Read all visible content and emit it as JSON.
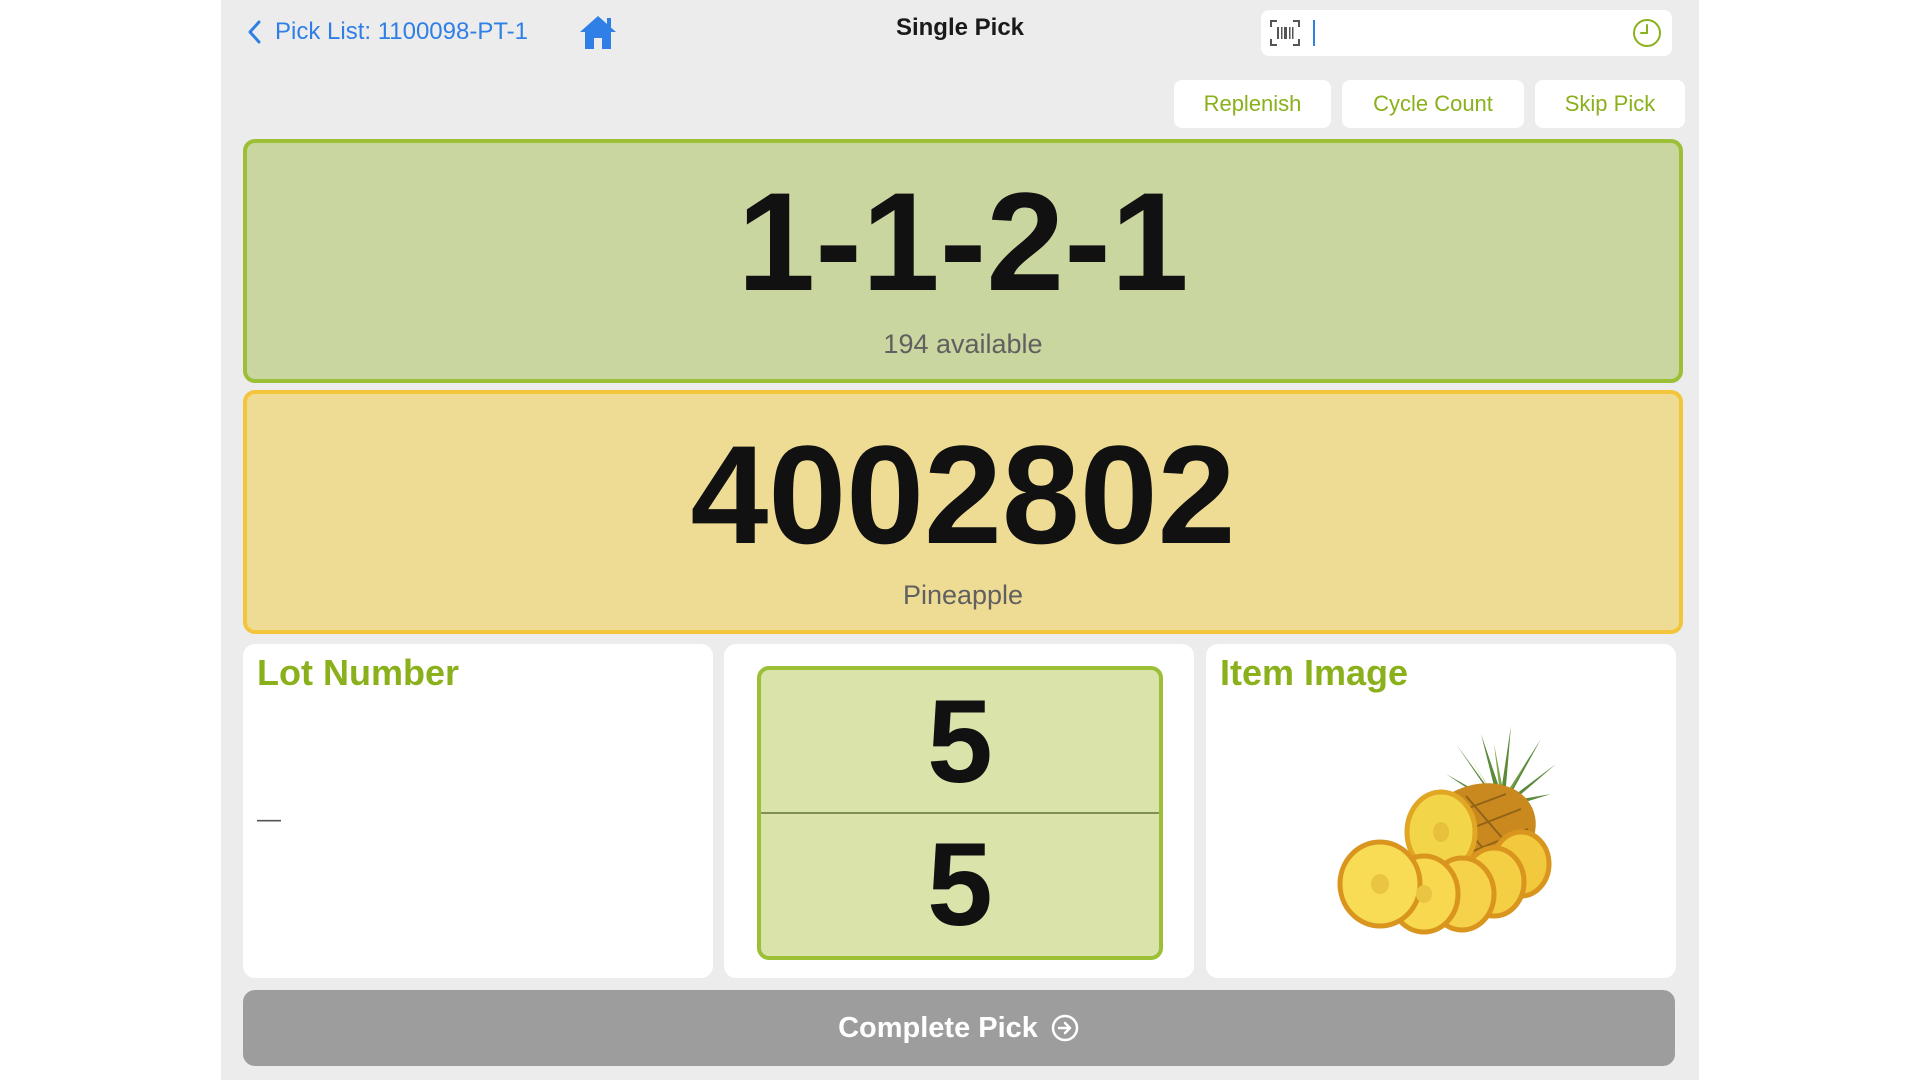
{
  "header": {
    "back_label": "Pick List: 1100098-PT-1",
    "title": "Single Pick",
    "scan_value": "",
    "scan_placeholder": ""
  },
  "actions": {
    "replenish_label": "Replenish",
    "cycle_count_label": "Cycle Count",
    "skip_pick_label": "Skip Pick"
  },
  "location": {
    "code": "1-1-2-1",
    "available_text": "194 available"
  },
  "item": {
    "number": "4002802",
    "name": "Pineapple"
  },
  "lot": {
    "title": "Lot Number",
    "value": "—"
  },
  "quantity": {
    "requested": "5",
    "picked": "5"
  },
  "image_panel": {
    "title": "Item Image",
    "image_icon": "pineapple-image"
  },
  "footer": {
    "complete_label": "Complete Pick"
  },
  "colors": {
    "accent_blue": "#2f7fe6",
    "accent_green": "#8ab01b",
    "location_bg": "#cad69f",
    "location_border": "#9bc036",
    "item_bg": "#efdc94",
    "item_border": "#f2c53c",
    "complete_disabled": "#9d9d9d"
  }
}
